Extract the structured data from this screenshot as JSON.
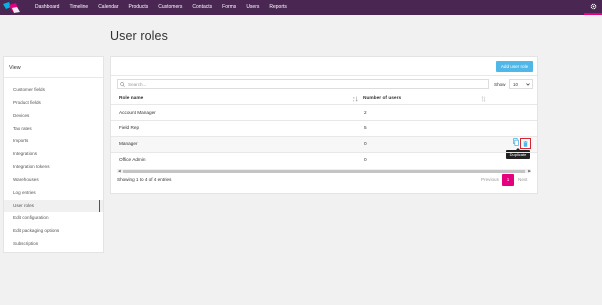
{
  "topbar": {
    "nav": [
      "Dashboard",
      "Timeline",
      "Calendar",
      "Products",
      "Customers",
      "Contacts",
      "Forms",
      "Users",
      "Reports"
    ],
    "accent": "#e7007e",
    "background": "#4a2653"
  },
  "page": {
    "title": "User roles"
  },
  "sidebar": {
    "heading": "View",
    "items": [
      {
        "label": "Customer fields"
      },
      {
        "label": "Product fields"
      },
      {
        "label": "Devices"
      },
      {
        "label": "Tax rates"
      },
      {
        "label": "Imports"
      },
      {
        "label": "Integrations"
      },
      {
        "label": "Integration tokens"
      },
      {
        "label": "Warehouses"
      },
      {
        "label": "Log entries"
      },
      {
        "label": "User roles"
      },
      {
        "label": "Edit configuration"
      },
      {
        "label": "Edit packaging options"
      },
      {
        "label": "Subscription"
      }
    ],
    "active": "User roles"
  },
  "toolbar": {
    "add_label": "Add user role",
    "search_placeholder": "Search...",
    "show_label": "Show",
    "show_value": "10"
  },
  "table": {
    "columns": [
      "Role name",
      "Number of users"
    ],
    "rows": [
      {
        "name": "Account Manager",
        "users": "2"
      },
      {
        "name": "Field Rep",
        "users": "5"
      },
      {
        "name": "Manager",
        "users": "0"
      },
      {
        "name": "Office Admin",
        "users": "0"
      }
    ],
    "tooltip": "Duplicate"
  },
  "footer": {
    "info": "Showing 1 to 4 of 4 entries",
    "prev": "Previous",
    "current": "1",
    "next": "Next"
  }
}
